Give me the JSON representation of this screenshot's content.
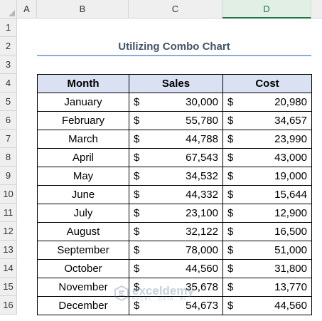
{
  "columns": [
    "A",
    "B",
    "C",
    "D"
  ],
  "rows": [
    "1",
    "2",
    "3",
    "4",
    "5",
    "6",
    "7",
    "8",
    "9",
    "10",
    "11",
    "12",
    "13",
    "14",
    "15",
    "16"
  ],
  "title": "Utilizing Combo Chart",
  "table": {
    "headers": [
      "Month",
      "Sales",
      "Cost"
    ],
    "currency": "$",
    "rows": [
      {
        "month": "January",
        "sales": "30,000",
        "cost": "20,980"
      },
      {
        "month": "February",
        "sales": "55,780",
        "cost": "34,657"
      },
      {
        "month": "March",
        "sales": "44,788",
        "cost": "23,990"
      },
      {
        "month": "April",
        "sales": "67,543",
        "cost": "43,000"
      },
      {
        "month": "May",
        "sales": "34,532",
        "cost": "19,000"
      },
      {
        "month": "June",
        "sales": "44,332",
        "cost": "15,644"
      },
      {
        "month": "July",
        "sales": "23,100",
        "cost": "12,900"
      },
      {
        "month": "August",
        "sales": "32,122",
        "cost": "16,500"
      },
      {
        "month": "September",
        "sales": "78,000",
        "cost": "51,000"
      },
      {
        "month": "October",
        "sales": "44,560",
        "cost": "31,800"
      },
      {
        "month": "November",
        "sales": "35,678",
        "cost": "13,770"
      },
      {
        "month": "December",
        "sales": "54,673",
        "cost": "44,560"
      }
    ]
  },
  "watermark": {
    "name": "exceldemy",
    "tagline": "EXCEL · DATA · BI"
  },
  "colors": {
    "header_fill": "#d9e1f2",
    "title_text": "#44546a",
    "title_rule": "#8ea9db",
    "selected_col": "#217346"
  }
}
